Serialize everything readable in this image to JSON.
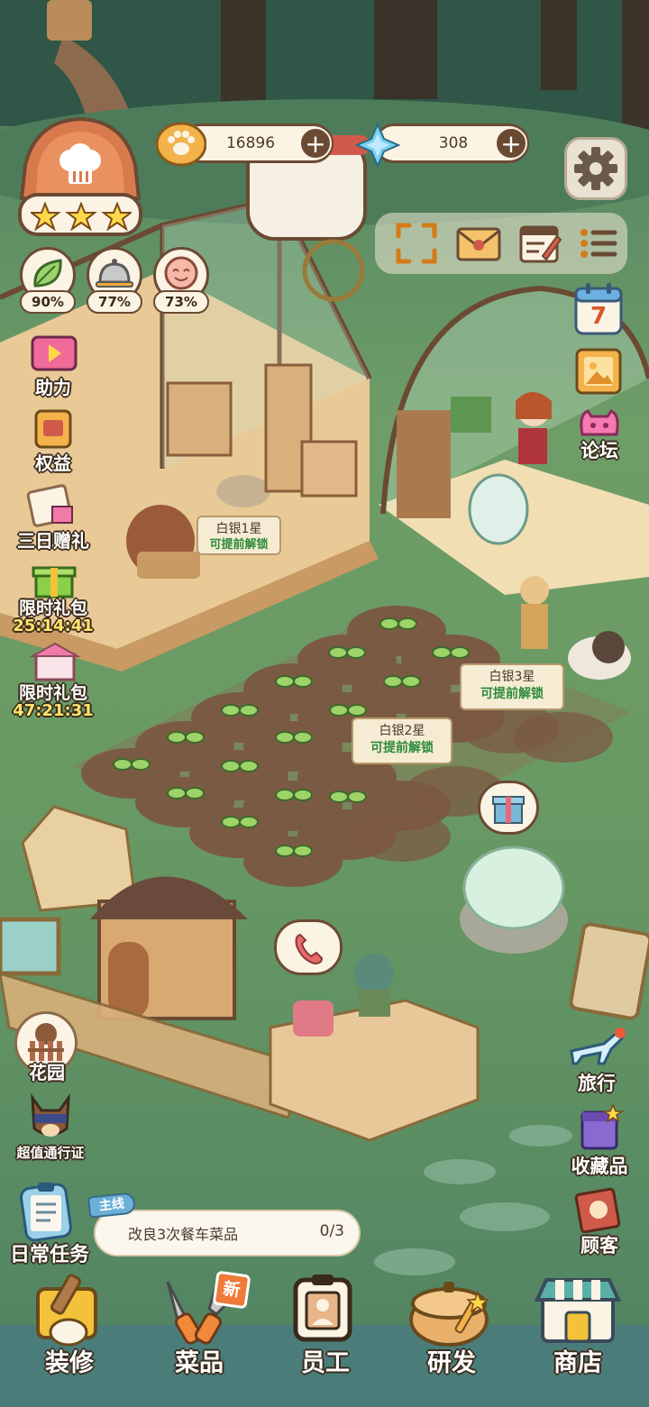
{
  "currency": {
    "coins": "16896",
    "gems": "308"
  },
  "stats": [
    {
      "icon": "leaf-icon",
      "value": "90%"
    },
    {
      "icon": "cloche-icon",
      "value": "77%"
    },
    {
      "icon": "smile-icon",
      "value": "73%"
    }
  ],
  "chef_badge": {
    "stars": 3,
    "icon": "chef-hat-icon"
  },
  "left_menu": {
    "assist": "助力",
    "benefits": "权益",
    "three_day_gift": "三日赠礼",
    "limited_pack_1": "限时礼包",
    "limited_pack_1_timer": "25:14:41",
    "limited_pack_2": "限时礼包",
    "limited_pack_2_timer": "47:21:31",
    "garden": "花园",
    "pass": "超值通行证",
    "daily_tasks": "日常任务"
  },
  "right_menu": {
    "calendar_day": "7",
    "forum": "论坛",
    "travel": "旅行",
    "collection": "收藏品",
    "customers": "顾客"
  },
  "unlock_signs": [
    {
      "line1": "白银1星",
      "line2": "可提前解锁"
    },
    {
      "line1": "白银2星",
      "line2": "可提前解锁"
    },
    {
      "line1": "白银3星",
      "line2": "可提前解锁"
    }
  ],
  "quest": {
    "tag": "主线",
    "text": "改良3次餐车菜品",
    "progress": "0/3"
  },
  "bottom_nav": [
    {
      "label": "装修",
      "icon": "paint-roller-icon"
    },
    {
      "label": "菜品",
      "icon": "utensils-icon",
      "badge": "新"
    },
    {
      "label": "员工",
      "icon": "staff-badge-icon"
    },
    {
      "label": "研发",
      "icon": "cooking-pot-icon"
    },
    {
      "label": "商店",
      "icon": "shop-icon"
    }
  ],
  "colors": {
    "grass": "#6a9a63",
    "wood_brown": "#6b4a33",
    "cream": "#fbf3e4",
    "timer_yellow": "#ffe46b",
    "unlock_green": "#2c8a3a"
  }
}
